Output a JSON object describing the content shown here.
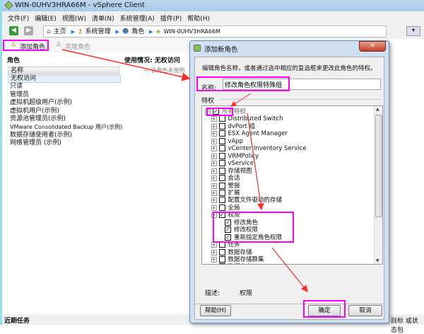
{
  "window": {
    "title": "WIN-0UHV3HRA66M - vSphere Client"
  },
  "menu": [
    "文件(F)",
    "编辑(E)",
    "视图(W)",
    "清单(N)",
    "系统管理(A)",
    "插件(P)",
    "帮助(H)"
  ],
  "breadcrumb": {
    "home": "主页",
    "admin": "系统管理",
    "roles": "角色",
    "host": "WIN-0UHV3HRA66M"
  },
  "toolbar": {
    "add_role": "添加角色",
    "clone_role": "克隆角色"
  },
  "left": {
    "header": "角色",
    "column": "名称",
    "usage_header": "使用情况: 无权访问",
    "usage_text": "— 该角色未使用",
    "roles": [
      "无权访问",
      "只读",
      "管理员",
      "虚拟机超级用户(示例)",
      "虚拟机用户(示例)",
      "资源池管理员(示例)",
      "VMware Consolidated Backup 用户(示例)",
      "数据存储使用者(示例)",
      "网络管理员 (示例)"
    ]
  },
  "bottom": {
    "recent_tasks": "近期任务",
    "right_text": "目标 或状态包"
  },
  "dialog": {
    "title": "添加新角色",
    "close": "✕",
    "instruction": "编辑角色名称，或者通过选中相应的复选框来更改此角色的特权。",
    "name_label": "名称:",
    "name_value": "修改角色权限特殊组",
    "priv_label": "特权",
    "tree": [
      {
        "label": "所有特权",
        "level": 0,
        "checked": true,
        "expand": "minus"
      },
      {
        "label": "Distributed Switch",
        "level": 1,
        "checked": false,
        "expand": "plus"
      },
      {
        "label": "dvPort 组",
        "level": 1,
        "checked": false,
        "expand": "plus"
      },
      {
        "label": "ESX Agent Manager",
        "level": 1,
        "checked": false,
        "expand": "plus"
      },
      {
        "label": "vApp",
        "level": 1,
        "checked": false,
        "expand": "plus"
      },
      {
        "label": "vCenter Inventory Service",
        "level": 1,
        "checked": false,
        "expand": "plus"
      },
      {
        "label": "VRMPolicy",
        "level": 1,
        "checked": false,
        "expand": "plus"
      },
      {
        "label": "vService",
        "level": 1,
        "checked": false,
        "expand": "plus"
      },
      {
        "label": "存储视图",
        "level": 1,
        "checked": false,
        "expand": "plus"
      },
      {
        "label": "会话",
        "level": 1,
        "checked": false,
        "expand": "plus"
      },
      {
        "label": "警报",
        "level": 1,
        "checked": false,
        "expand": "plus"
      },
      {
        "label": "扩展",
        "level": 1,
        "checked": false,
        "expand": "plus"
      },
      {
        "label": "配置文件驱动的存储",
        "level": 1,
        "checked": false,
        "expand": "plus"
      },
      {
        "label": "全局",
        "level": 1,
        "checked": false,
        "expand": "plus"
      },
      {
        "label": "权限",
        "level": 1,
        "checked": true,
        "expand": "minus"
      },
      {
        "label": "修改角色",
        "level": 2,
        "checked": true,
        "expand": ""
      },
      {
        "label": "修改权限",
        "level": 2,
        "checked": true,
        "expand": ""
      },
      {
        "label": "重新指定角色权限",
        "level": 2,
        "checked": true,
        "expand": ""
      },
      {
        "label": "任务",
        "level": 1,
        "checked": false,
        "expand": "plus"
      },
      {
        "label": "数据存储",
        "level": 1,
        "checked": false,
        "expand": "plus"
      },
      {
        "label": "数据存储群集",
        "level": 1,
        "checked": false,
        "expand": "plus"
      },
      {
        "label": "数据中心",
        "level": 1,
        "checked": false,
        "expand": "plus"
      }
    ],
    "desc_label": "描述:",
    "desc_value": "权限",
    "help": "帮助(H)",
    "ok": "确定",
    "cancel": "取消"
  },
  "colors": {
    "highlight": "#ff00ff",
    "arrow": "#ff2a2a"
  }
}
